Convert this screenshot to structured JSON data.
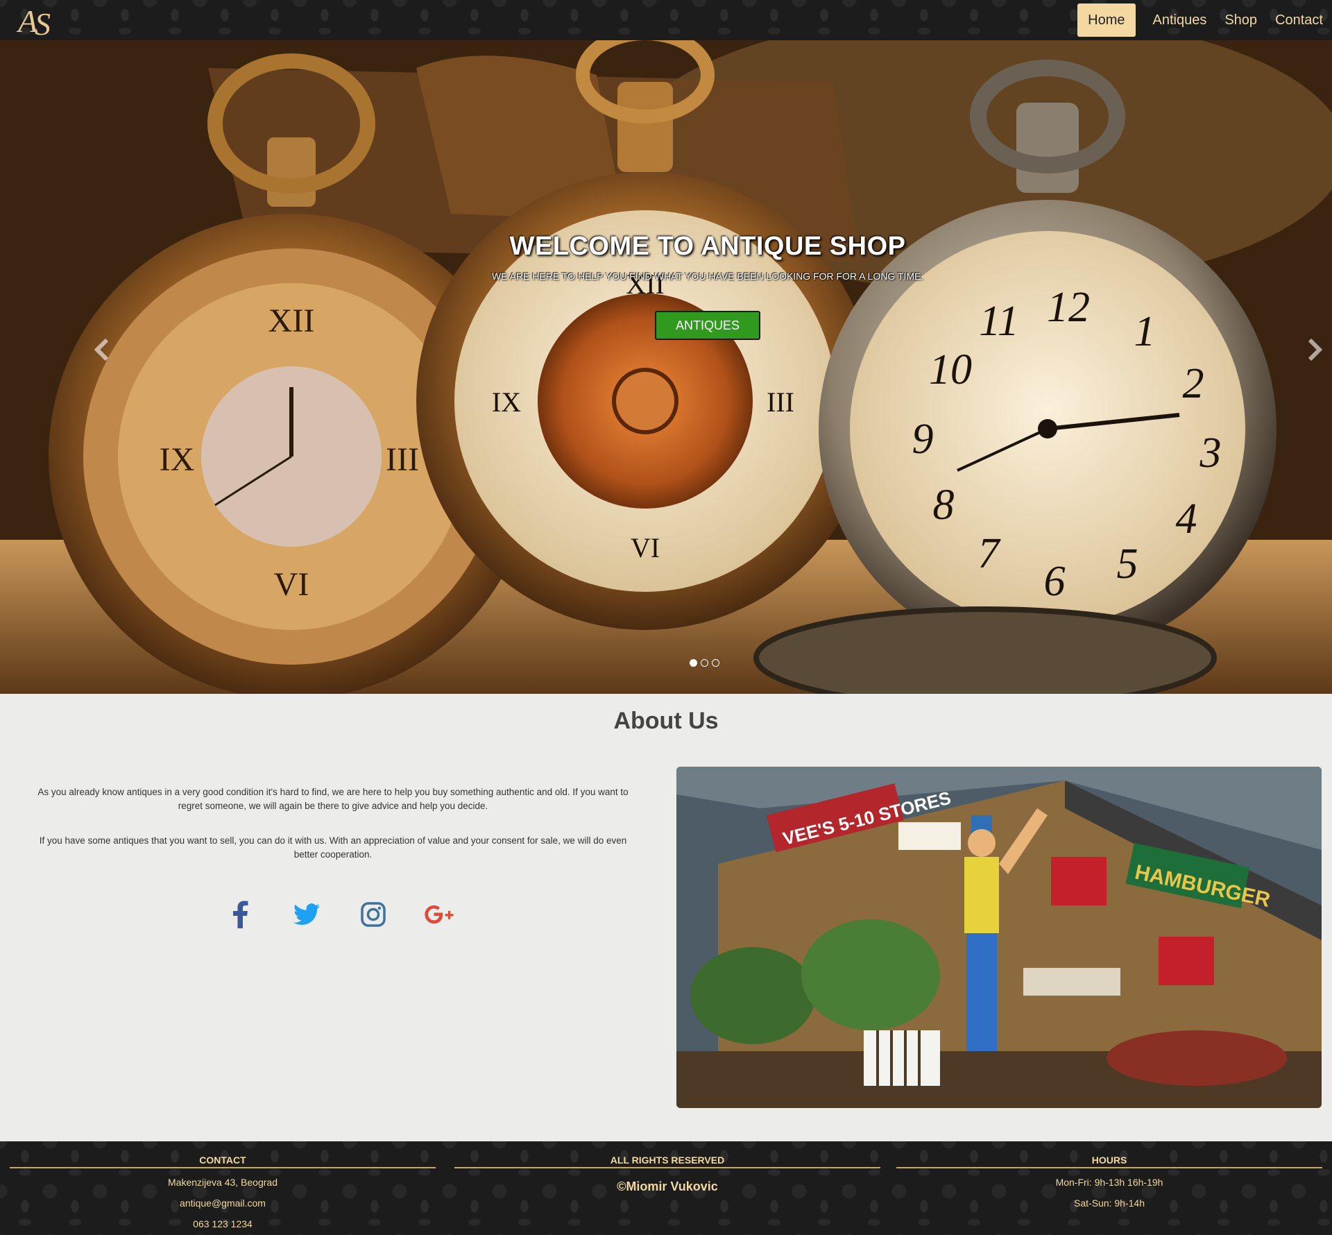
{
  "header": {
    "logo_text": "AS",
    "nav": [
      "Home",
      "Antiques",
      "Shop",
      "Contact"
    ]
  },
  "hero": {
    "title": "WELCOME TO ANTIQUE SHOP",
    "subtitle": "WE ARE HERE TO HELP YOU FIND WHAT YOU HAVE BEEN LOOKING FOR FOR A LONG TIME.",
    "button": "ANTIQUES",
    "slides": 3,
    "active_slide": 1,
    "prev_icon": "chevron-left-icon",
    "next_icon": "chevron-right-icon"
  },
  "about": {
    "title": "About Us",
    "paragraphs": [
      "As you already know antiques in a very good condition it's hard to find, we are here to help you buy something authentic and old. If you want to regret someone, we will again be there to give advice and help you decide.",
      "If you have some antiques that you want to sell, you can do it with us. With an appreciation of value and your consent for sale, we will do even better cooperation."
    ],
    "social": [
      {
        "name": "facebook-icon",
        "color": "#3b5998"
      },
      {
        "name": "twitter-icon",
        "color": "#1da1f2"
      },
      {
        "name": "instagram-icon",
        "color": "#3f729b"
      },
      {
        "name": "google-plus-icon",
        "color": "#dd4b39"
      }
    ]
  },
  "footer": {
    "contact": {
      "title": "CONTACT",
      "address": "Makenzijeva 43, Beograd",
      "email": "antique@gmail.com",
      "phone": "063 123 1234"
    },
    "rights": {
      "title": "ALL RIGHTS RESERVED",
      "credit": "©Miomir Vukovic"
    },
    "hours": {
      "title": "HOURS",
      "weekdays": "Mon-Fri: 9h-13h 16h-19h",
      "weekend": "Sat-Sun: 9h-14h"
    }
  },
  "colors": {
    "accent": "#f3d9a1",
    "button_green": "#2f9a1d",
    "dark_bg": "#1c1c1c"
  }
}
